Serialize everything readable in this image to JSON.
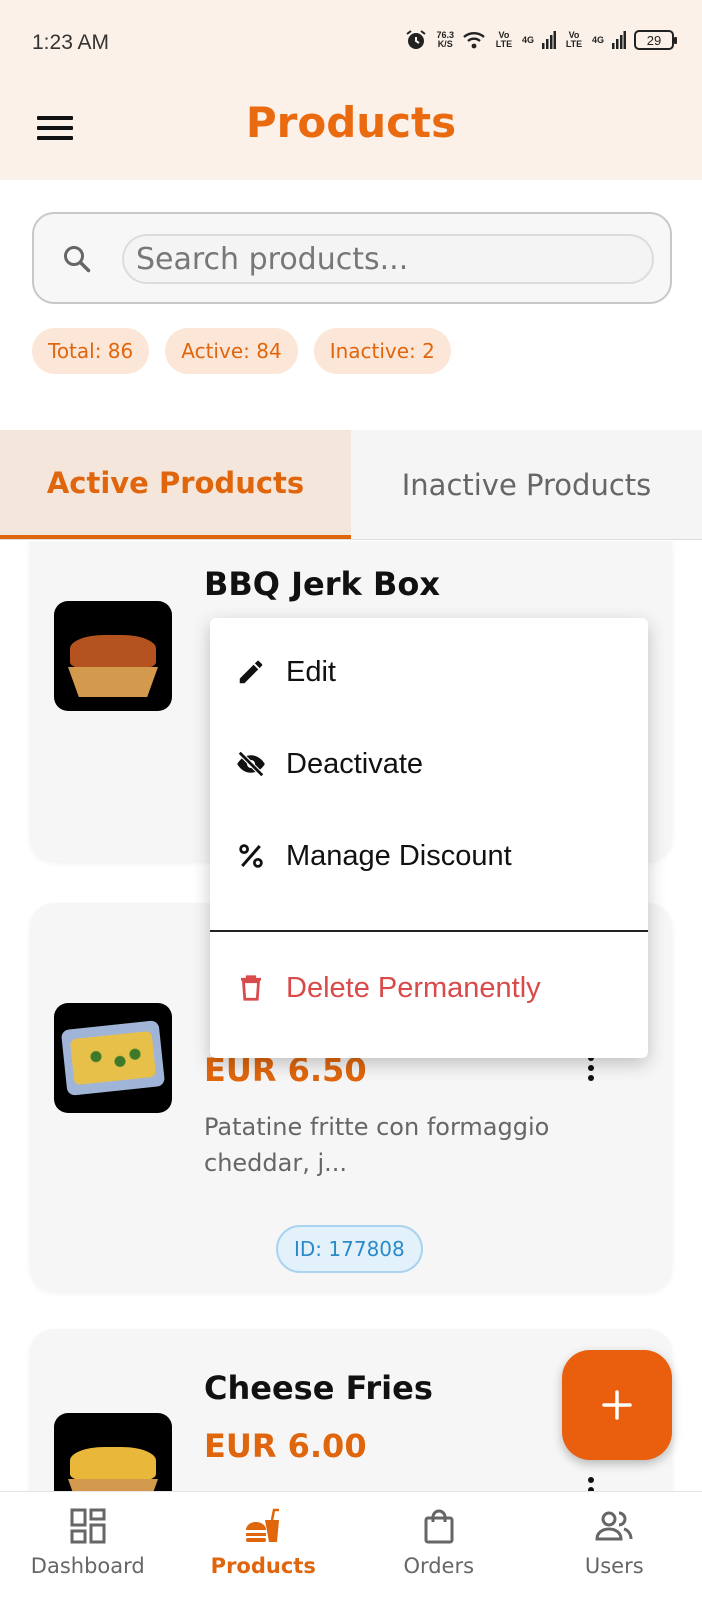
{
  "status_bar": {
    "time": "1:23 AM",
    "net_speed_value": "76.3",
    "net_speed_unit": "K/S",
    "sim1": "Vo LTE",
    "sim1_net": "4G",
    "sim2": "Vo LTE",
    "sim2_net": "4G",
    "battery": "29"
  },
  "app_bar": {
    "title": "Products",
    "menu_icon": "hamburger-icon"
  },
  "search": {
    "placeholder": "Search products...",
    "value": ""
  },
  "stats": {
    "total": "Total: 86",
    "active": "Active: 84",
    "inactive": "Inactive: 2"
  },
  "tabs": [
    {
      "label": "Active Products",
      "selected": true
    },
    {
      "label": "Inactive Products",
      "selected": false
    }
  ],
  "products": [
    {
      "name": "BBQ Jerk Box",
      "price": "",
      "description": ""
    },
    {
      "name": "",
      "price": "EUR 6.50",
      "description": "Patatine fritte con formaggio cheddar, j...",
      "id": "ID: 177808"
    },
    {
      "name": "Cheese Fries",
      "price": "EUR 6.00",
      "description": ""
    }
  ],
  "context_menu": {
    "edit": "Edit",
    "deactivate": "Deactivate",
    "discount": "Manage Discount",
    "delete": "Delete Permanently"
  },
  "fab": {
    "icon": "plus-icon"
  },
  "bottom_nav": [
    {
      "label": "Dashboard",
      "icon": "dashboard-icon",
      "active": false
    },
    {
      "label": "Products",
      "icon": "fastfood-icon",
      "active": true
    },
    {
      "label": "Orders",
      "icon": "shopping-bag-icon",
      "active": false
    },
    {
      "label": "Users",
      "icon": "users-icon",
      "active": false
    }
  ],
  "colors": {
    "accent": "#e0660d",
    "app_bar_bg": "#fbf1e9",
    "danger": "#d94a4a",
    "id_badge": "#2a8bc8"
  }
}
